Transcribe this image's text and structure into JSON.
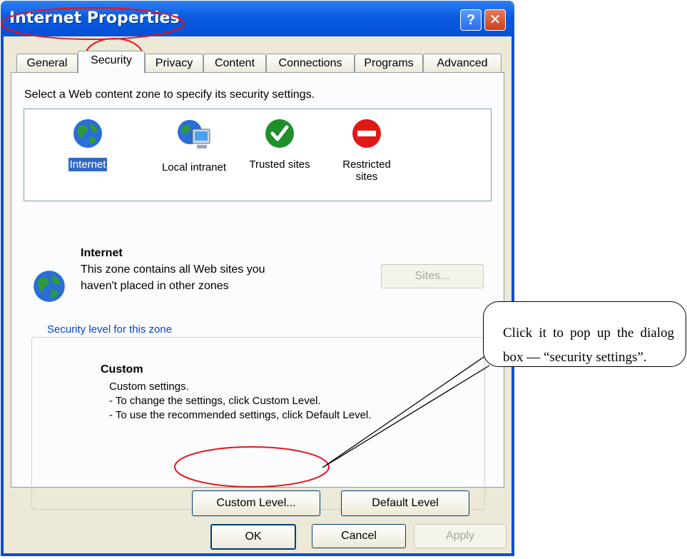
{
  "window": {
    "title": "Internet Properties",
    "help_glyph": "?",
    "close_glyph": "✕"
  },
  "tabs": [
    {
      "label": "General"
    },
    {
      "label": "Security",
      "active": true
    },
    {
      "label": "Privacy"
    },
    {
      "label": "Content"
    },
    {
      "label": "Connections"
    },
    {
      "label": "Programs"
    },
    {
      "label": "Advanced"
    }
  ],
  "security": {
    "zone_prompt": "Select a Web content zone to specify its security settings.",
    "zones": [
      {
        "label": "Internet",
        "icon": "globe-icon",
        "selected": true
      },
      {
        "label": "Local intranet",
        "icon": "intranet-icon"
      },
      {
        "label": "Trusted sites",
        "icon": "checkmark-icon"
      },
      {
        "label": "Restricted sites",
        "icon": "no-entry-icon"
      }
    ],
    "zone_title": "Internet",
    "zone_desc_line1": "This zone contains all Web sites you",
    "zone_desc_line2": "haven't placed in other zones",
    "sites_button": "Sites...",
    "group_label": "Security level for this zone",
    "level_title": "Custom",
    "level_lines": [
      "Custom settings.",
      "- To change the settings, click Custom Level.",
      "- To use the recommended settings, click Default Level."
    ],
    "custom_level_button": "Custom Level...",
    "default_level_button": "Default Level"
  },
  "footer": {
    "ok": "OK",
    "cancel": "Cancel",
    "apply": "Apply"
  },
  "annotation": {
    "callout_text": "Click it to pop up the dialog box — “security settings”.",
    "highlight_color": "#e8141c"
  },
  "colors": {
    "titlebar": "#0a5be0",
    "dialog_bg": "#ece9d8",
    "selection": "#316ac5",
    "group_label": "#0046d5"
  }
}
